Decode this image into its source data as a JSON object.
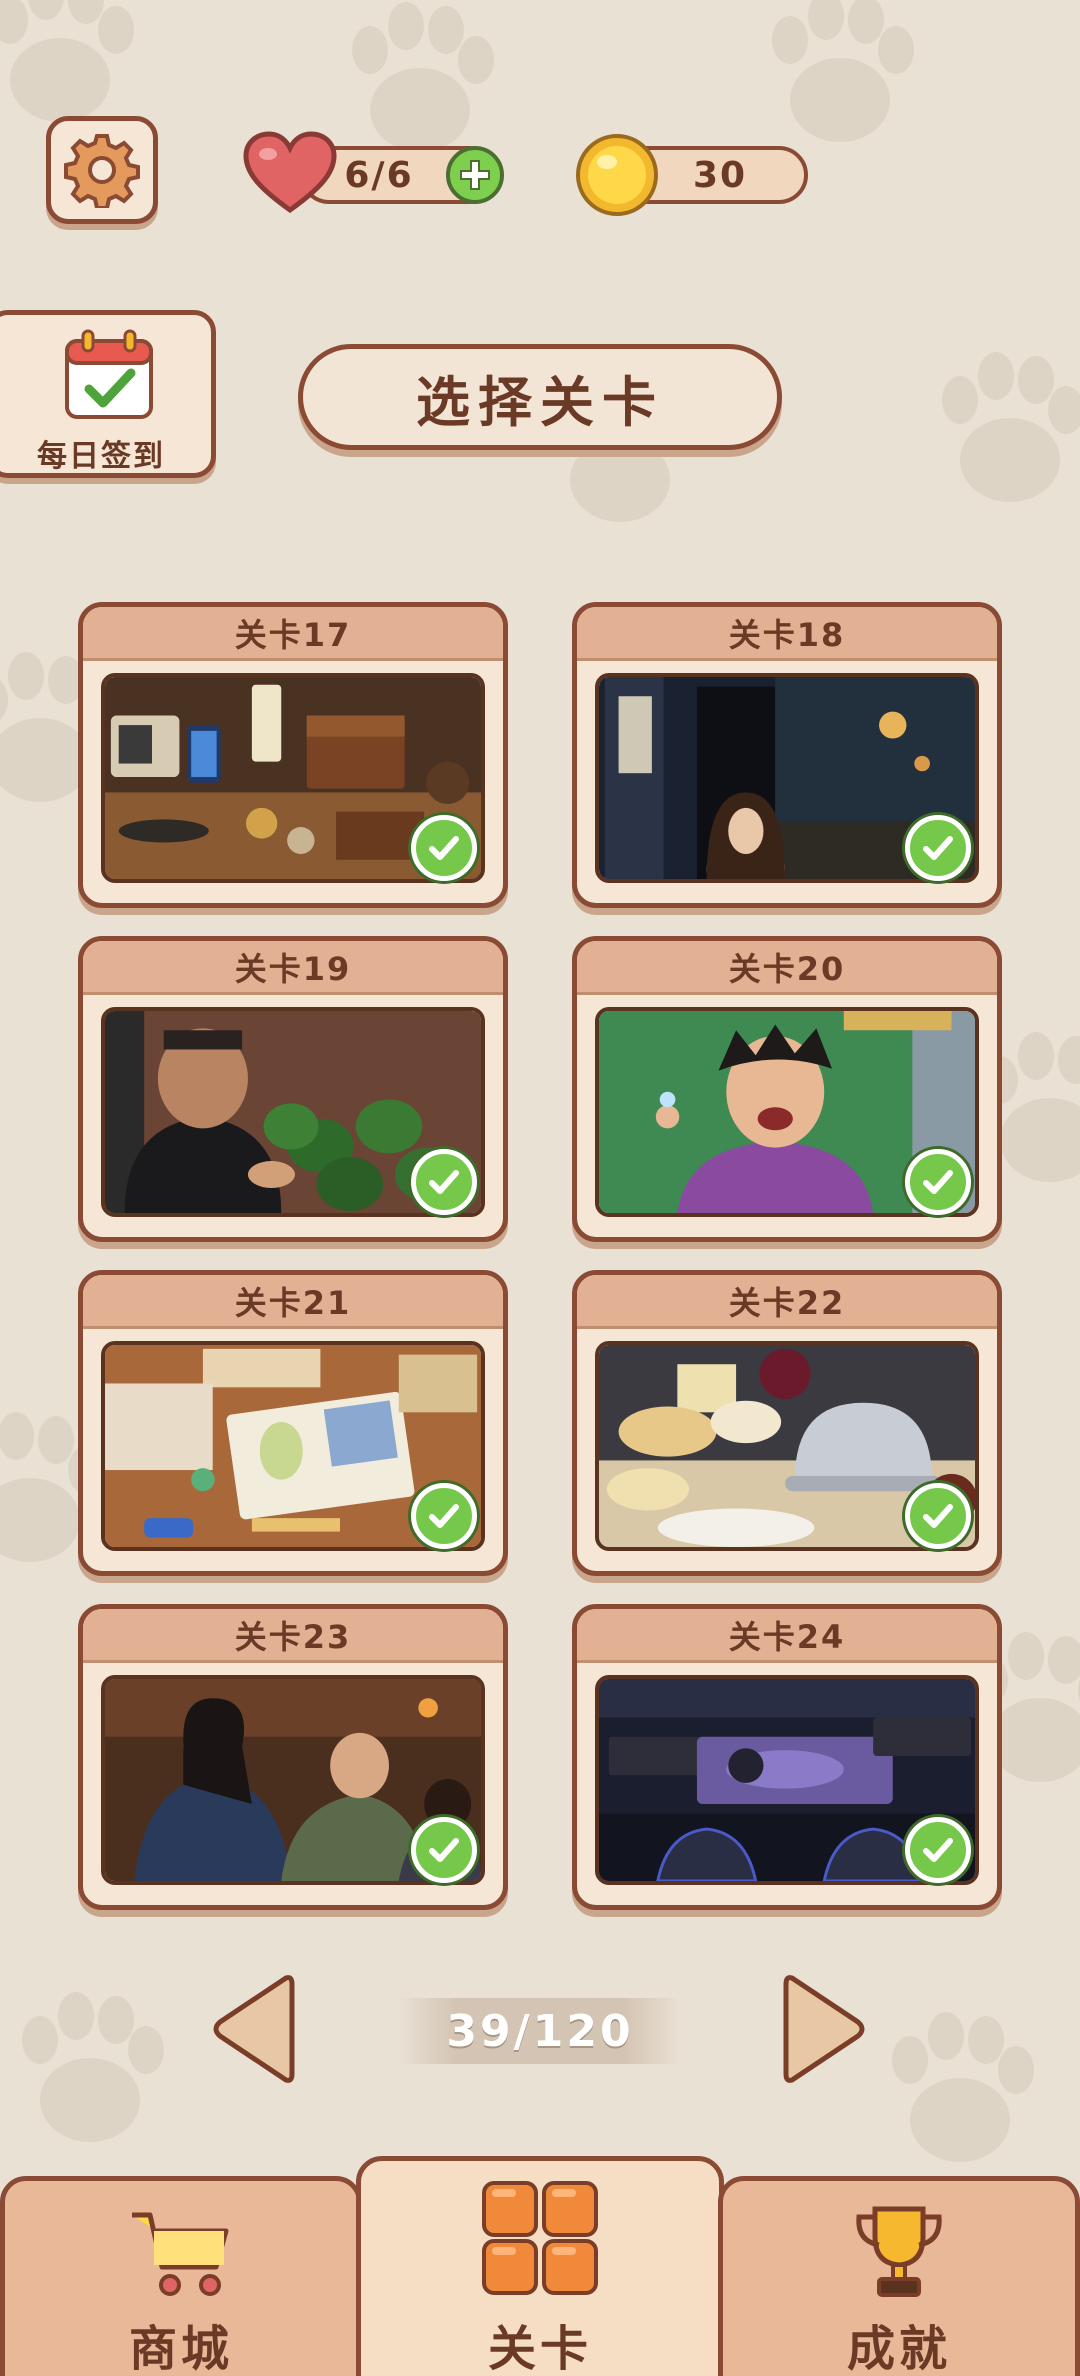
{
  "header": {
    "settings_icon": "gear-icon",
    "lives": "6/6",
    "lives_icon": "heart-icon",
    "add_lives_icon": "plus-icon",
    "coins": "30",
    "coins_icon": "coin-icon"
  },
  "daily": {
    "label": "每日签到",
    "icon": "calendar-check-icon"
  },
  "title": "选择关卡",
  "levels": [
    {
      "label": "关卡17",
      "completed": true
    },
    {
      "label": "关卡18",
      "completed": true
    },
    {
      "label": "关卡19",
      "completed": true
    },
    {
      "label": "关卡20",
      "completed": true
    },
    {
      "label": "关卡21",
      "completed": true
    },
    {
      "label": "关卡22",
      "completed": true
    },
    {
      "label": "关卡23",
      "completed": true
    },
    {
      "label": "关卡24",
      "completed": true
    }
  ],
  "pager": {
    "counter": "39/120"
  },
  "nav": {
    "shop": "商城",
    "levels": "关卡",
    "achievements": "成就"
  },
  "colors": {
    "background": "#e9e1d4",
    "border": "#8a4a34",
    "accent_green": "#76c84a",
    "text_brown": "#6b3a26"
  }
}
